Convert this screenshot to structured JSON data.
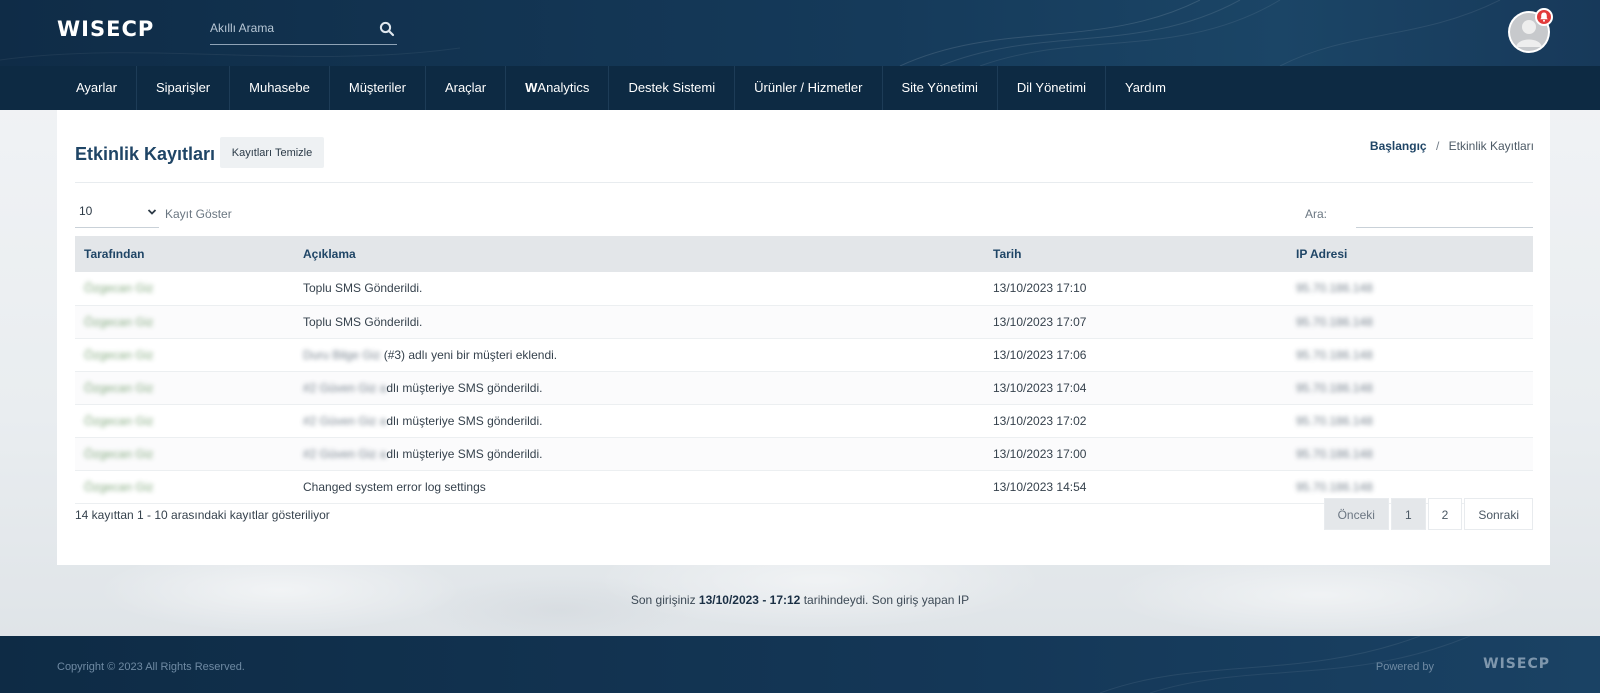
{
  "header": {
    "logo_text": "WISECP",
    "search_placeholder": "Akıllı Arama"
  },
  "nav": {
    "items": [
      {
        "label": "Ayarlar"
      },
      {
        "label": "Siparişler"
      },
      {
        "label": "Muhasebe"
      },
      {
        "label": "Müşteriler"
      },
      {
        "label": "Araçlar"
      },
      {
        "label_bold": "W",
        "label": "Analytics"
      },
      {
        "label": "Destek Sistemi"
      },
      {
        "label": "Ürünler / Hizmetler"
      },
      {
        "label": "Site Yönetimi"
      },
      {
        "label": "Dil Yönetimi"
      },
      {
        "label": "Yardım"
      }
    ]
  },
  "page": {
    "title": "Etkinlik Kayıtları",
    "clear_button": "Kayıtları Temizle",
    "breadcrumb": {
      "home": "Başlangıç",
      "separator": "/",
      "current": "Etkinlik Kayıtları"
    },
    "length_value": "10",
    "length_label": "Kayıt Göster",
    "search_label": "Ara:"
  },
  "table": {
    "columns": [
      "Tarafından",
      "Açıklama",
      "Tarih",
      "IP Adresi"
    ],
    "rows": [
      {
        "by": "Özgecan Giz",
        "desc_blur": "",
        "desc": "Toplu SMS Gönderildi.",
        "date": "13/10/2023 17:10",
        "ip": "95.70.186.148"
      },
      {
        "by": "Özgecan Giz",
        "desc_blur": "",
        "desc": "Toplu SMS Gönderildi.",
        "date": "13/10/2023 17:07",
        "ip": "95.70.186.148"
      },
      {
        "by": "Özgecan Giz",
        "desc_blur": "Duru Bilge Giz",
        "desc": " (#3) adlı yeni bir müşteri eklendi.",
        "date": "13/10/2023 17:06",
        "ip": "95.70.186.148"
      },
      {
        "by": "Özgecan Giz",
        "desc_blur": "#2 Güven Giz a",
        "desc": "dlı müşteriye SMS gönderildi.",
        "date": "13/10/2023 17:04",
        "ip": "95.70.186.148"
      },
      {
        "by": "Özgecan Giz",
        "desc_blur": "#2 Güven Giz a",
        "desc": "dlı müşteriye SMS gönderildi.",
        "date": "13/10/2023 17:02",
        "ip": "95.70.186.148"
      },
      {
        "by": "Özgecan Giz",
        "desc_blur": "#2 Güven Giz a",
        "desc": "dlı müşteriye SMS gönderildi.",
        "date": "13/10/2023 17:00",
        "ip": "95.70.186.148"
      },
      {
        "by": "Özgecan Giz",
        "desc_blur": "",
        "desc": "Changed system error log settings",
        "date": "13/10/2023 14:54",
        "ip": "95.70.186.148"
      }
    ]
  },
  "info": "14 kayıttan 1 - 10 arasındaki kayıtlar gösteriliyor",
  "pager": {
    "prev": "Önceki",
    "pages": [
      "1",
      "2"
    ],
    "next": "Sonraki"
  },
  "last_login": {
    "prefix": "Son girişiniz",
    "datetime": "13/10/2023 - 17:12",
    "suffix": "tarihindeydi. Son giriş yapan IP"
  },
  "footer": {
    "copyright": "Copyright © 2023 All Rights Reserved.",
    "powered": "Powered by",
    "logo_text": "WISECP"
  },
  "colors": {
    "header": "#153a5a",
    "nav": "#0d2a43",
    "accent": "#1f4566",
    "notification": "#e23b3b"
  },
  "icons": {
    "search": "search-icon",
    "select": "chevron-down-icon",
    "avatar": "user-icon",
    "notification": "bell-icon"
  }
}
